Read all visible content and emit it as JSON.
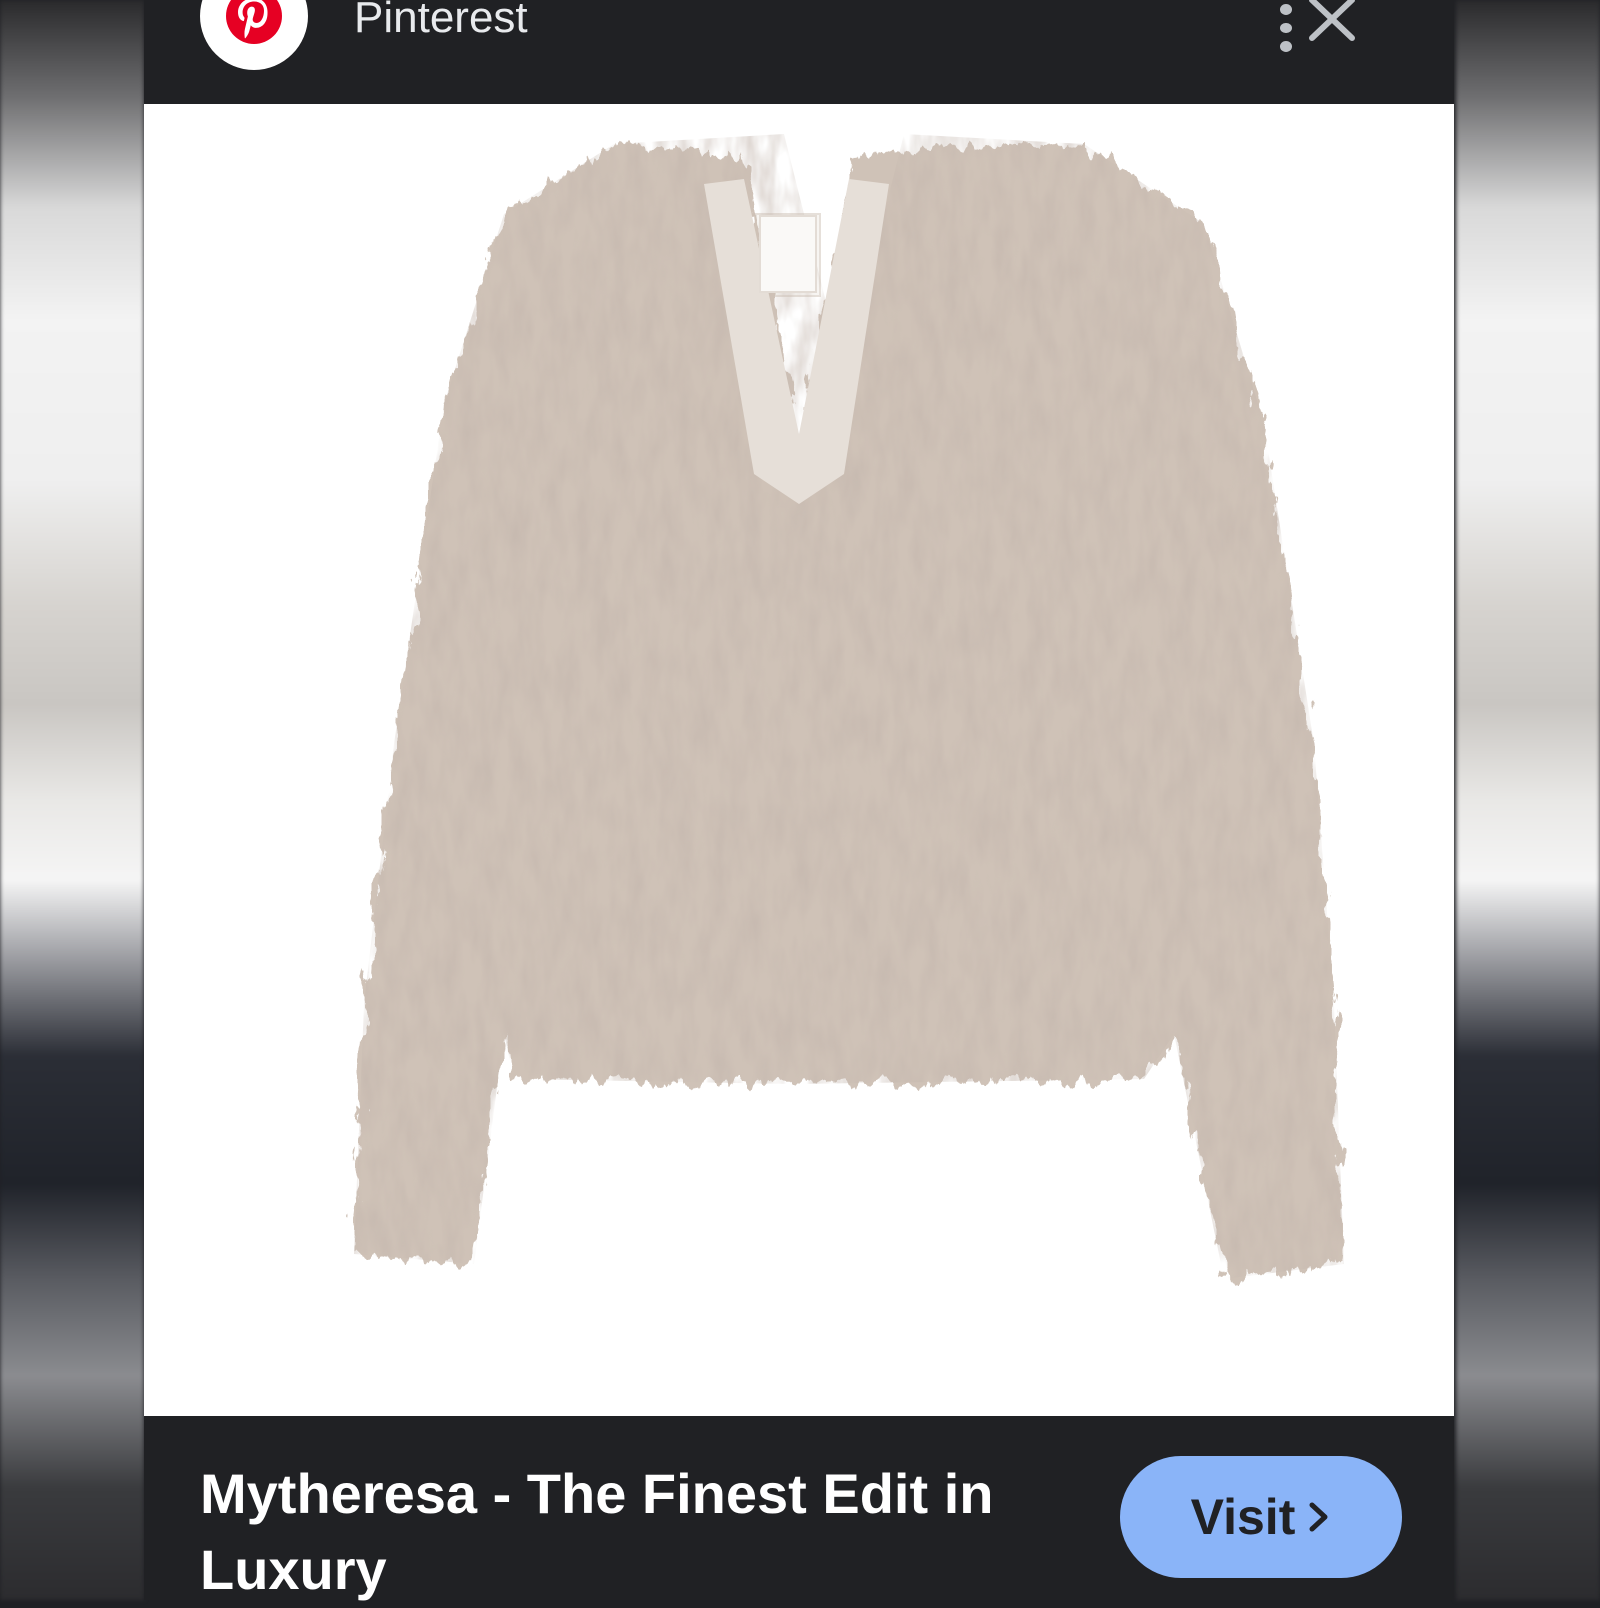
{
  "header": {
    "source_name": "Pinterest",
    "logo_icon": "pinterest-logo-icon",
    "menu_icon": "more-vert-icon",
    "close_icon": "close-icon"
  },
  "image": {
    "subject": "fluffy-jacket-product-image"
  },
  "footer": {
    "caption": "Mytheresa - The Finest Edit in Luxury",
    "visit_label": "Visit",
    "visit_icon": "chevron-right-icon"
  },
  "colors": {
    "brand_red": "#e60023",
    "visit_button": "#8ab4f8",
    "panel_bg": "#202124"
  }
}
